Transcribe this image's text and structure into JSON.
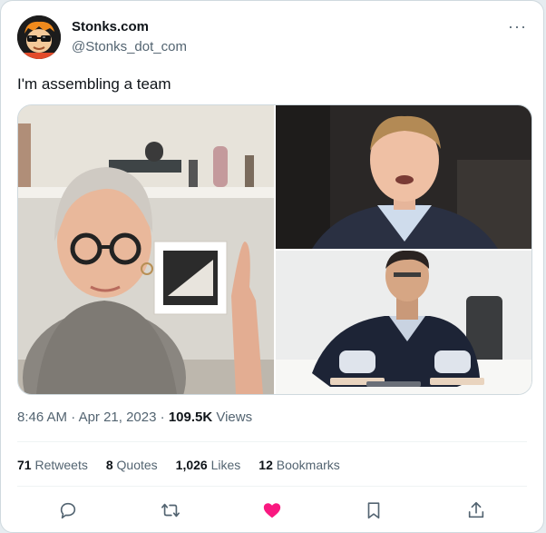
{
  "tweet": {
    "author_name": "Stonks.com",
    "author_handle": "@Stonks_dot_com",
    "text": "I'm assembling a team",
    "time": "8:46 AM",
    "date": "Apr 21, 2023",
    "views_count": "109.5K",
    "views_label": "Views",
    "more_label": "···"
  },
  "stats": {
    "retweets_count": "71",
    "retweets_label": "Retweets",
    "quotes_count": "8",
    "quotes_label": "Quotes",
    "likes_count": "1,026",
    "likes_label": "Likes",
    "bookmarks_count": "12",
    "bookmarks_label": "Bookmarks"
  },
  "actions": [
    {
      "icon": "reply-icon"
    },
    {
      "icon": "retweet-icon"
    },
    {
      "icon": "heart-icon",
      "active": true
    },
    {
      "icon": "bookmark-icon"
    },
    {
      "icon": "share-icon"
    }
  ],
  "colors": {
    "like": "#f91880",
    "muted": "#536471",
    "text": "#0f1419",
    "border": "#cfd9de",
    "avatar_hair": "#f08a1c"
  }
}
